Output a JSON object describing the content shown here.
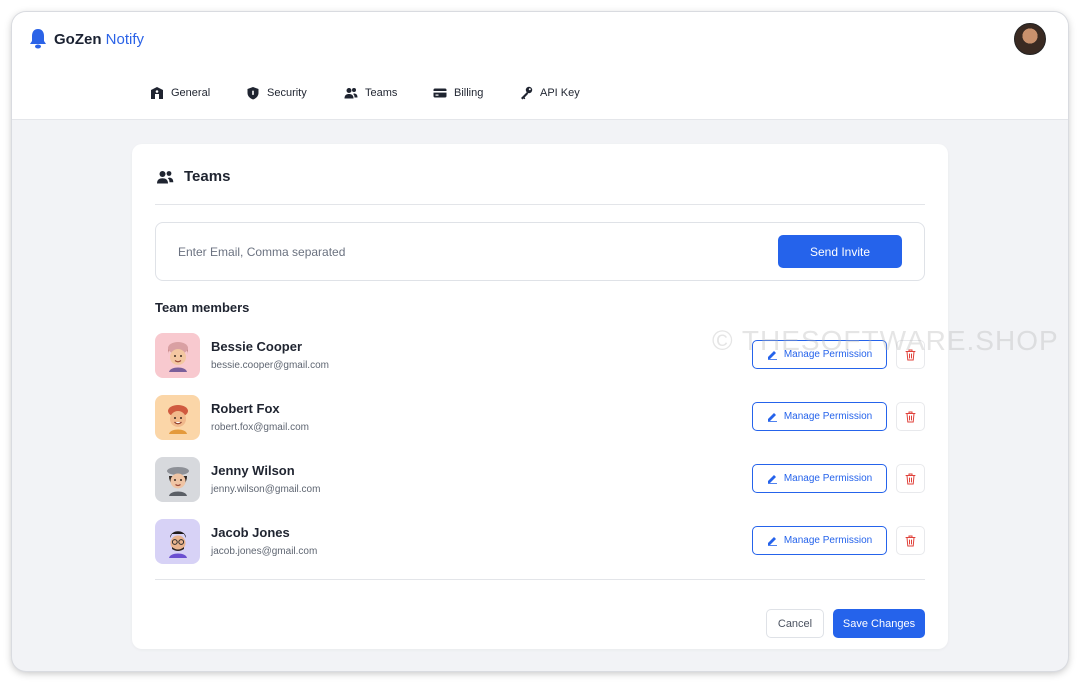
{
  "app": {
    "brand_part1": "GoZen",
    "brand_part2": "Notify",
    "accent_color": "#2563eb"
  },
  "tabs": [
    {
      "label": "General",
      "icon": "building-icon"
    },
    {
      "label": "Security",
      "icon": "shield-icon"
    },
    {
      "label": "Teams",
      "icon": "users-icon"
    },
    {
      "label": "Billing",
      "icon": "card-icon"
    },
    {
      "label": "API Key",
      "icon": "key-icon"
    }
  ],
  "teams": {
    "title": "Teams",
    "invite_placeholder": "Enter Email, Comma separated",
    "send_invite_label": "Send Invite",
    "members_label": "Team members",
    "manage_label": "Manage Permission",
    "members": [
      {
        "name": "Bessie Cooper",
        "email": "bessie.cooper@gmail.com",
        "avatar_bg": "#f8c9cf"
      },
      {
        "name": "Robert Fox",
        "email": "robert.fox@gmail.com",
        "avatar_bg": "#fbd6a8"
      },
      {
        "name": "Jenny Wilson",
        "email": "jenny.wilson@gmail.com",
        "avatar_bg": "#d7d9dd"
      },
      {
        "name": "Jacob Jones",
        "email": "jacob.jones@gmail.com",
        "avatar_bg": "#d7d2f6"
      }
    ],
    "cancel_label": "Cancel",
    "save_label": "Save Changes"
  },
  "watermark": "© THESOFTWARE.SHOP"
}
